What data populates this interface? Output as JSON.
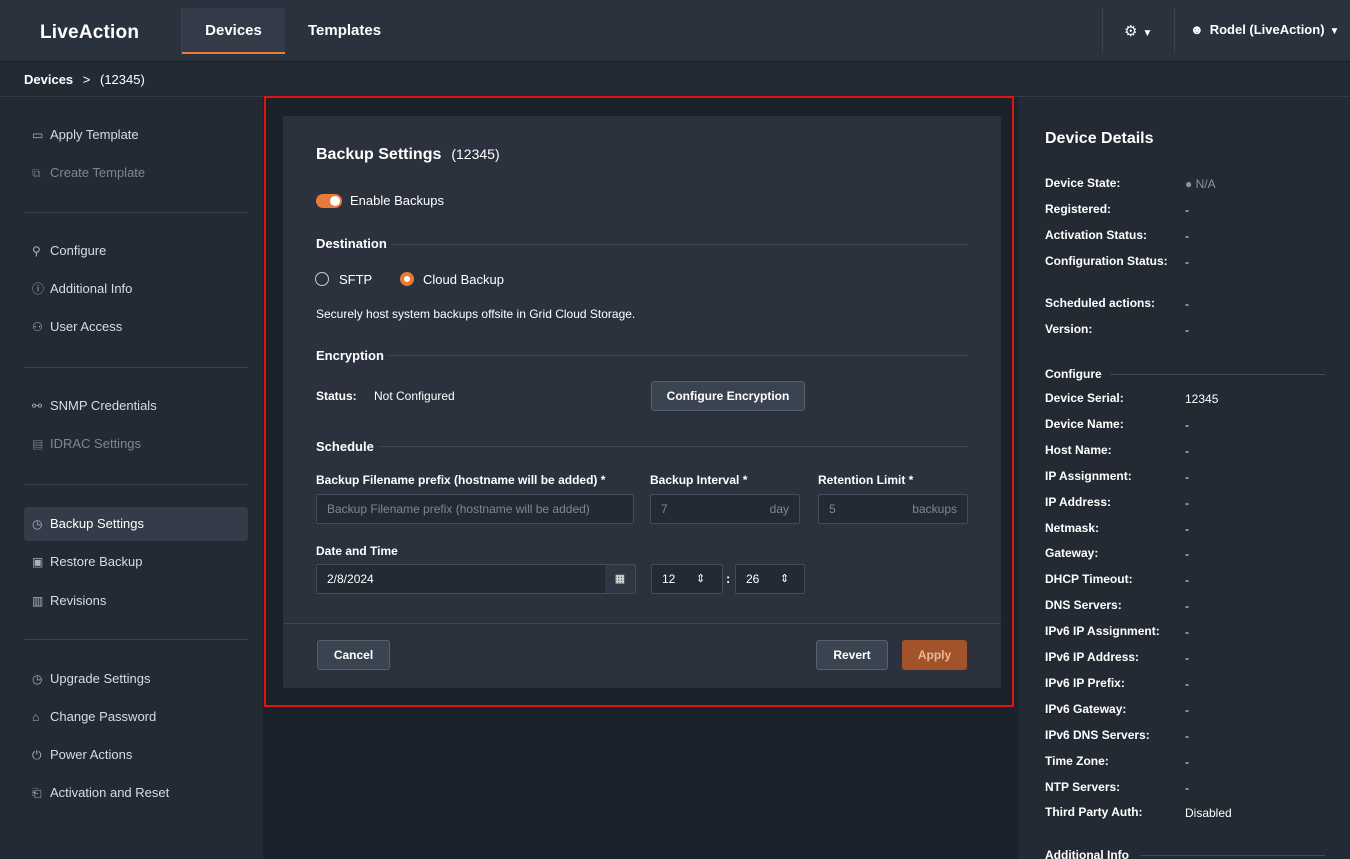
{
  "brand": "LiveAction",
  "nav": {
    "devices": "Devices",
    "templates": "Templates"
  },
  "user": {
    "name": "Rodel (LiveAction)"
  },
  "breadcrumb": {
    "root": "Devices",
    "sep": ">",
    "current": "(12345)"
  },
  "sidebar": {
    "apply_template": "Apply Template",
    "create_template": "Create Template",
    "configure": "Configure",
    "additional_info": "Additional Info",
    "user_access": "User Access",
    "snmp": "SNMP Credentials",
    "idrac": "IDRAC Settings",
    "backup": "Backup Settings",
    "restore": "Restore Backup",
    "revisions": "Revisions",
    "upgrade": "Upgrade Settings",
    "change_password": "Change Password",
    "power": "Power Actions",
    "activation": "Activation and Reset"
  },
  "backup": {
    "title": "Backup Settings",
    "device_id": "(12345)",
    "enable_label": "Enable Backups",
    "enabled": true,
    "destination_label": "Destination",
    "options": {
      "sftp": "SFTP",
      "cloud": "Cloud Backup"
    },
    "selected_option": "Cloud Backup",
    "cloud_desc": "Securely host system backups offsite in Grid Cloud Storage.",
    "encryption_label": "Encryption",
    "status_label": "Status:",
    "status_value": "Not Configured",
    "configure_encryption": "Configure Encryption",
    "schedule_label": "Schedule",
    "prefix_label": "Backup Filename prefix (hostname will be added) *",
    "prefix_placeholder": "Backup Filename prefix (hostname will be added)",
    "interval_label": "Backup Interval *",
    "interval_value": "7",
    "interval_unit": "day",
    "retention_label": "Retention Limit *",
    "retention_value": "5",
    "retention_unit": "backups",
    "datetime_label": "Date and Time",
    "date_value": "2/8/2024",
    "hour": "12",
    "minute": "26",
    "cancel": "Cancel",
    "revert": "Revert",
    "apply": "Apply"
  },
  "details": {
    "title": "Device Details",
    "state_rows": [
      {
        "key": "Device State:",
        "value": "● N/A",
        "dim": true
      },
      {
        "key": "Registered:",
        "value": "-"
      },
      {
        "key": "Activation Status:",
        "value": "-"
      },
      {
        "key": "Configuration Status:",
        "value": "-"
      },
      {
        "key": "Scheduled actions:",
        "value": "-"
      },
      {
        "key": "Version:",
        "value": "-"
      }
    ],
    "configure_title": "Configure",
    "configure_rows": [
      {
        "key": "Device Serial:",
        "value": "12345"
      },
      {
        "key": "Device Name:",
        "value": "-"
      },
      {
        "key": "Host Name:",
        "value": "-"
      },
      {
        "key": "IP Assignment:",
        "value": "-"
      },
      {
        "key": "IP Address:",
        "value": "-"
      },
      {
        "key": "Netmask:",
        "value": "-"
      },
      {
        "key": "Gateway:",
        "value": "-"
      },
      {
        "key": "DHCP Timeout:",
        "value": "-"
      },
      {
        "key": "DNS Servers:",
        "value": "-"
      },
      {
        "key": "IPv6 IP Assignment:",
        "value": "-"
      },
      {
        "key": "IPv6 IP Address:",
        "value": "-"
      },
      {
        "key": "IPv6 IP Prefix:",
        "value": "-"
      },
      {
        "key": "IPv6 Gateway:",
        "value": "-"
      },
      {
        "key": "IPv6 DNS Servers:",
        "value": "-"
      },
      {
        "key": "Time Zone:",
        "value": "-"
      },
      {
        "key": "NTP Servers:",
        "value": "-"
      },
      {
        "key": "Third Party Auth:",
        "value": "Disabled"
      }
    ],
    "additional_title": "Additional Info"
  },
  "colors": {
    "accent": "#e87b3a",
    "highlight": "#e3140f",
    "apply_bg": "#a2532a"
  }
}
